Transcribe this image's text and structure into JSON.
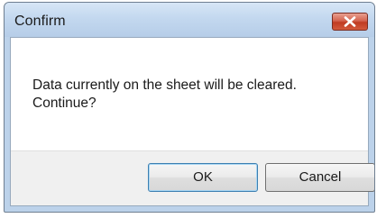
{
  "window": {
    "title": "Confirm",
    "close_icon": "close-icon"
  },
  "message": {
    "text_line1": "Data currently on the sheet will be cleared.",
    "text_line2": "Continue?"
  },
  "buttons": {
    "ok_label": "OK",
    "cancel_label": "Cancel"
  },
  "colors": {
    "titlebar": "#c3d8ef",
    "close_button": "#c8452b",
    "footer": "#f0f0f0",
    "default_button_border": "#3c7fb1"
  }
}
